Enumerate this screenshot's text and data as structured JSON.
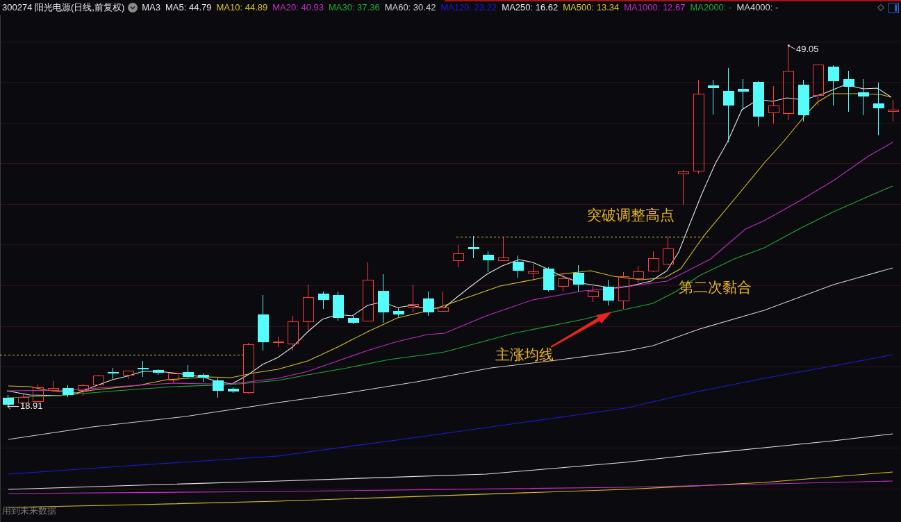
{
  "header": {
    "title": "300274 阳光电源(日线,前复权)",
    "indicators": [
      {
        "label": "MA3",
        "color": "#e6e6e6"
      },
      {
        "label": "MA5: 44.79",
        "color": "#e6e6e6"
      },
      {
        "label": "MA10: 44.89",
        "color": "#d8c424"
      },
      {
        "label": "MA20: 40.93",
        "color": "#c42cc8"
      },
      {
        "label": "MA30: 37.36",
        "color": "#22a83a"
      },
      {
        "label": "MA60: 30.42",
        "color": "#d2d2d2"
      },
      {
        "label": "MA120: 23.22",
        "color": "#1c1cd6"
      },
      {
        "label": "MA250: 16.62",
        "color": "#e6e6e6"
      },
      {
        "label": "MA500: 13.34",
        "color": "#d8c424"
      },
      {
        "label": "MA1000: 12.67",
        "color": "#c42cc8"
      },
      {
        "label": "MA2000: -",
        "color": "#22a83a"
      },
      {
        "label": "MA4000: -",
        "color": "#d2d2d2"
      }
    ]
  },
  "chart": {
    "price_labels": [
      "49.05",
      "18.91"
    ],
    "annotations": [
      "突破调整高点",
      "第二次黏合",
      "主涨均线"
    ]
  },
  "footer_note": "用到未来数据"
}
